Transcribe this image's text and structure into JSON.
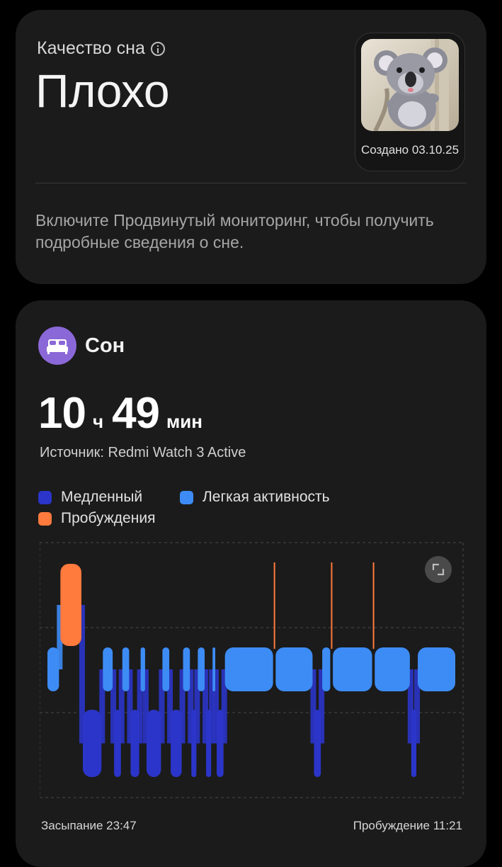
{
  "quality": {
    "label": "Качество сна",
    "value": "Плохо",
    "avatar_caption": "Создано 03.10.25",
    "hint": "Включите Продвинутый мониторинг, чтобы получить подробные сведения о сне."
  },
  "sleep": {
    "title": "Сон",
    "duration_hours": "10",
    "duration_hours_unit": "ч",
    "duration_minutes": "49",
    "duration_minutes_unit": "мин",
    "source": "Источник: Redmi Watch 3 Active",
    "legend": [
      {
        "label": "Медленный",
        "color": "#2b35c9"
      },
      {
        "label": "Легкая активность",
        "color": "#3d8cf5"
      },
      {
        "label": "Пробуждения",
        "color": "#ff7a3d"
      }
    ],
    "sleep_start": "Засыпание 23:47",
    "wake_up": "Пробуждение 11:21"
  },
  "colors": {
    "deep": "#2b35c9",
    "light": "#3d8cf5",
    "awake": "#ff7a3d",
    "accent_icon": "#8b68d8"
  },
  "chart_data": {
    "type": "bar",
    "levels": [
      "Пробуждения",
      "Легкая активность",
      "Медленный"
    ],
    "start": "23:47",
    "end": "11:21",
    "segments": [
      {
        "stage": "Легкая активность",
        "start": "23:47",
        "end": "00:09"
      },
      {
        "stage": "Пробуждения",
        "start": "00:09",
        "end": "00:47"
      },
      {
        "stage": "Медленный",
        "start": "00:47",
        "end": "01:21"
      },
      {
        "stage": "Легкая активность",
        "start": "01:21",
        "end": "01:40"
      },
      {
        "stage": "Медленный",
        "start": "01:40",
        "end": "01:54"
      },
      {
        "stage": "Легкая активность",
        "start": "01:54",
        "end": "02:08"
      },
      {
        "stage": "Медленный",
        "start": "02:08",
        "end": "02:25"
      },
      {
        "stage": "Легкая активность",
        "start": "02:25",
        "end": "02:35"
      },
      {
        "stage": "Медленный",
        "start": "02:35",
        "end": "03:02"
      },
      {
        "stage": "Легкая активность",
        "start": "03:02",
        "end": "03:16"
      },
      {
        "stage": "Медленный",
        "start": "03:16",
        "end": "03:37"
      },
      {
        "stage": "Легкая активность",
        "start": "03:37",
        "end": "03:51"
      },
      {
        "stage": "Медленный",
        "start": "03:51",
        "end": "04:02"
      },
      {
        "stage": "Легкая активность",
        "start": "04:02",
        "end": "04:16"
      },
      {
        "stage": "Медленный",
        "start": "04:16",
        "end": "04:27"
      },
      {
        "stage": "Легкая активность",
        "start": "04:27",
        "end": "04:34"
      },
      {
        "stage": "Медленный",
        "start": "04:34",
        "end": "04:48"
      },
      {
        "stage": "Легкая активность",
        "start": "04:48",
        "end": "06:12"
      },
      {
        "stage": "Пробуждения",
        "start": "06:12",
        "end": "06:14"
      },
      {
        "stage": "Легкая активность",
        "start": "06:14",
        "end": "07:19"
      },
      {
        "stage": "Медленный",
        "start": "07:19",
        "end": "07:33"
      },
      {
        "stage": "Легкая активность",
        "start": "07:33",
        "end": "07:49"
      },
      {
        "stage": "Пробуждения",
        "start": "07:49",
        "end": "07:51"
      },
      {
        "stage": "Легкая активность",
        "start": "07:51",
        "end": "09:00"
      },
      {
        "stage": "Пробуждения",
        "start": "09:00",
        "end": "09:02"
      },
      {
        "stage": "Легкая активность",
        "start": "09:02",
        "end": "10:04"
      },
      {
        "stage": "Медленный",
        "start": "10:04",
        "end": "10:15"
      },
      {
        "stage": "Легкая активность",
        "start": "10:15",
        "end": "11:21"
      }
    ]
  }
}
